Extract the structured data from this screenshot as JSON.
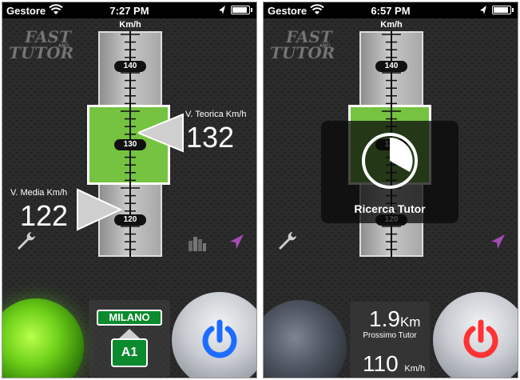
{
  "left": {
    "status": {
      "carrier": "Gestore",
      "time": "7:27 PM"
    },
    "logo": {
      "line1": "FAST",
      "small": "AND",
      "line2": "TUTOR"
    },
    "scale_unit": "Km/h",
    "ticks": [
      "140",
      "130",
      "120"
    ],
    "theoretical": {
      "label": "V. Teorica Km/h",
      "value": "132"
    },
    "average": {
      "label": "V. Media Km/h",
      "value": "122"
    },
    "sign": {
      "city": "MILANO",
      "road": "A1"
    },
    "colors": {
      "traffic_light": "#6fd11a",
      "power_icon": "#1e6cff",
      "sign_green": "#0c8a2e"
    }
  },
  "right": {
    "status": {
      "carrier": "Gestore",
      "time": "6:57 PM"
    },
    "logo": {
      "line1": "FAST",
      "small": "AND",
      "line2": "TUTOR"
    },
    "scale_unit": "Km/h",
    "ticks": [
      "140",
      "130",
      "120"
    ],
    "overlay": {
      "title": "Ricerca Tutor"
    },
    "info": {
      "distance": "1.9",
      "distance_unit": "Km",
      "distance_label": "Prossimo Tutor",
      "speed": "110",
      "speed_unit": "Km/h"
    },
    "colors": {
      "power_icon": "#ff3333"
    }
  }
}
